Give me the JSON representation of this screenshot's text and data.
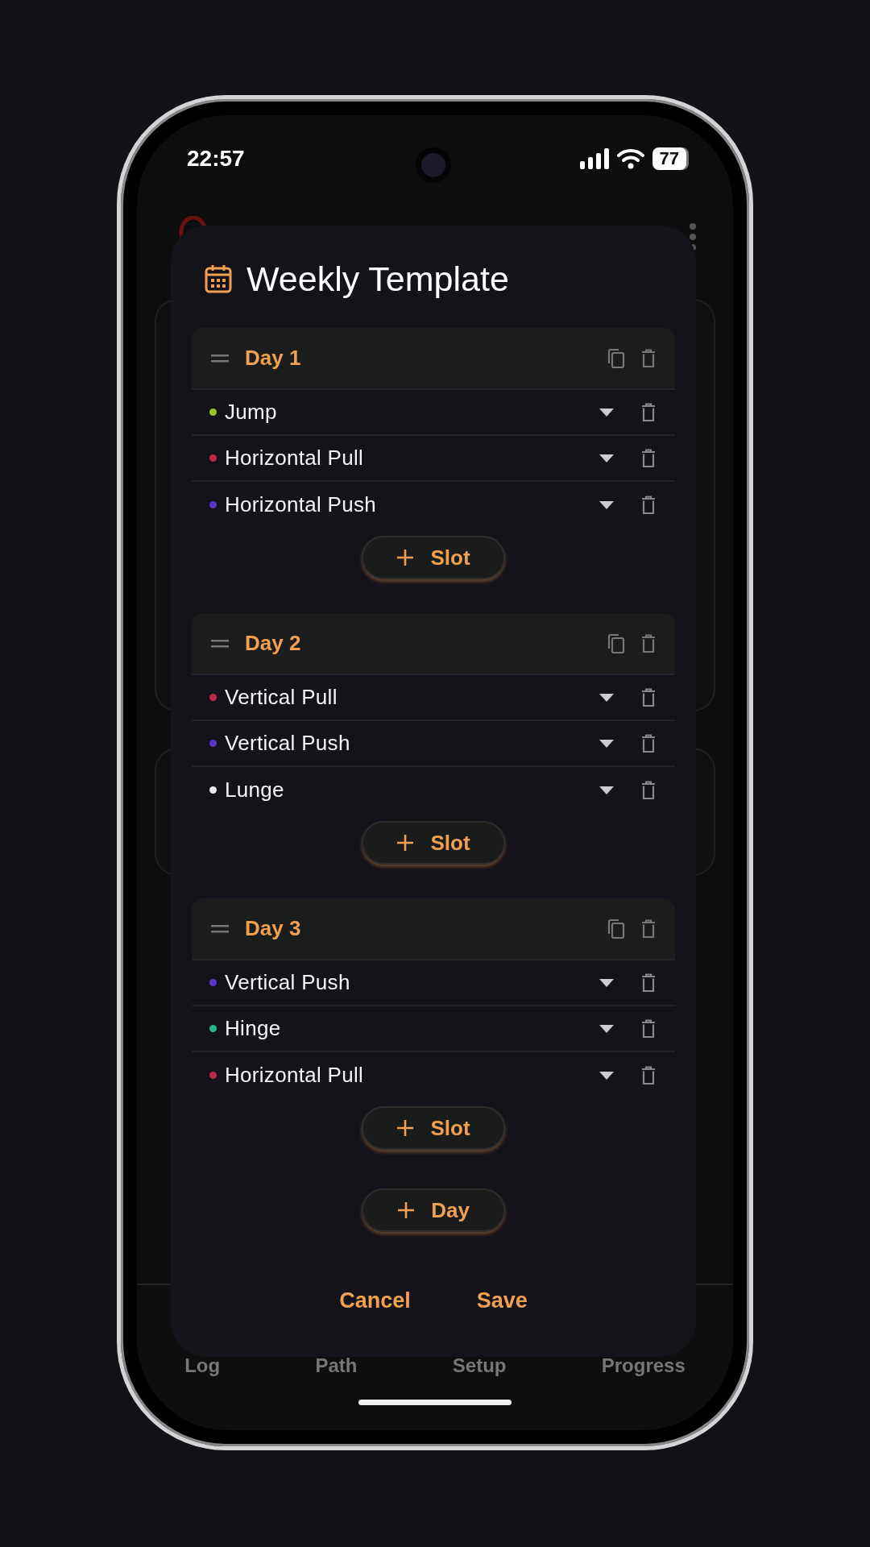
{
  "status_bar": {
    "time": "22:57",
    "battery": "77"
  },
  "dialog": {
    "title": "Weekly Template",
    "days": [
      {
        "name": "Day 1",
        "add_slot": "Slot",
        "slots": [
          {
            "name": "Jump",
            "color": "#9ac22a"
          },
          {
            "name": "Horizontal Pull",
            "color": "#c0264a"
          },
          {
            "name": "Horizontal Push",
            "color": "#5b34c8"
          }
        ]
      },
      {
        "name": "Day 2",
        "add_slot": "Slot",
        "slots": [
          {
            "name": "Vertical Pull",
            "color": "#c0264a"
          },
          {
            "name": "Vertical Push",
            "color": "#5b34c8"
          },
          {
            "name": "Lunge",
            "color": "#e8e8e8"
          }
        ]
      },
      {
        "name": "Day 3",
        "add_slot": "Slot",
        "slots": [
          {
            "name": "Vertical Push",
            "color": "#5b34c8"
          },
          {
            "name": "Hinge",
            "color": "#2bb58a"
          },
          {
            "name": "Horizontal Pull",
            "color": "#c0264a"
          }
        ]
      }
    ],
    "add_day": "Day",
    "actions": [
      "Cancel",
      "Save"
    ]
  },
  "bottom_nav": [
    {
      "label": "Log"
    },
    {
      "label": "Path"
    },
    {
      "label": "Setup"
    },
    {
      "label": "Progress"
    }
  ]
}
